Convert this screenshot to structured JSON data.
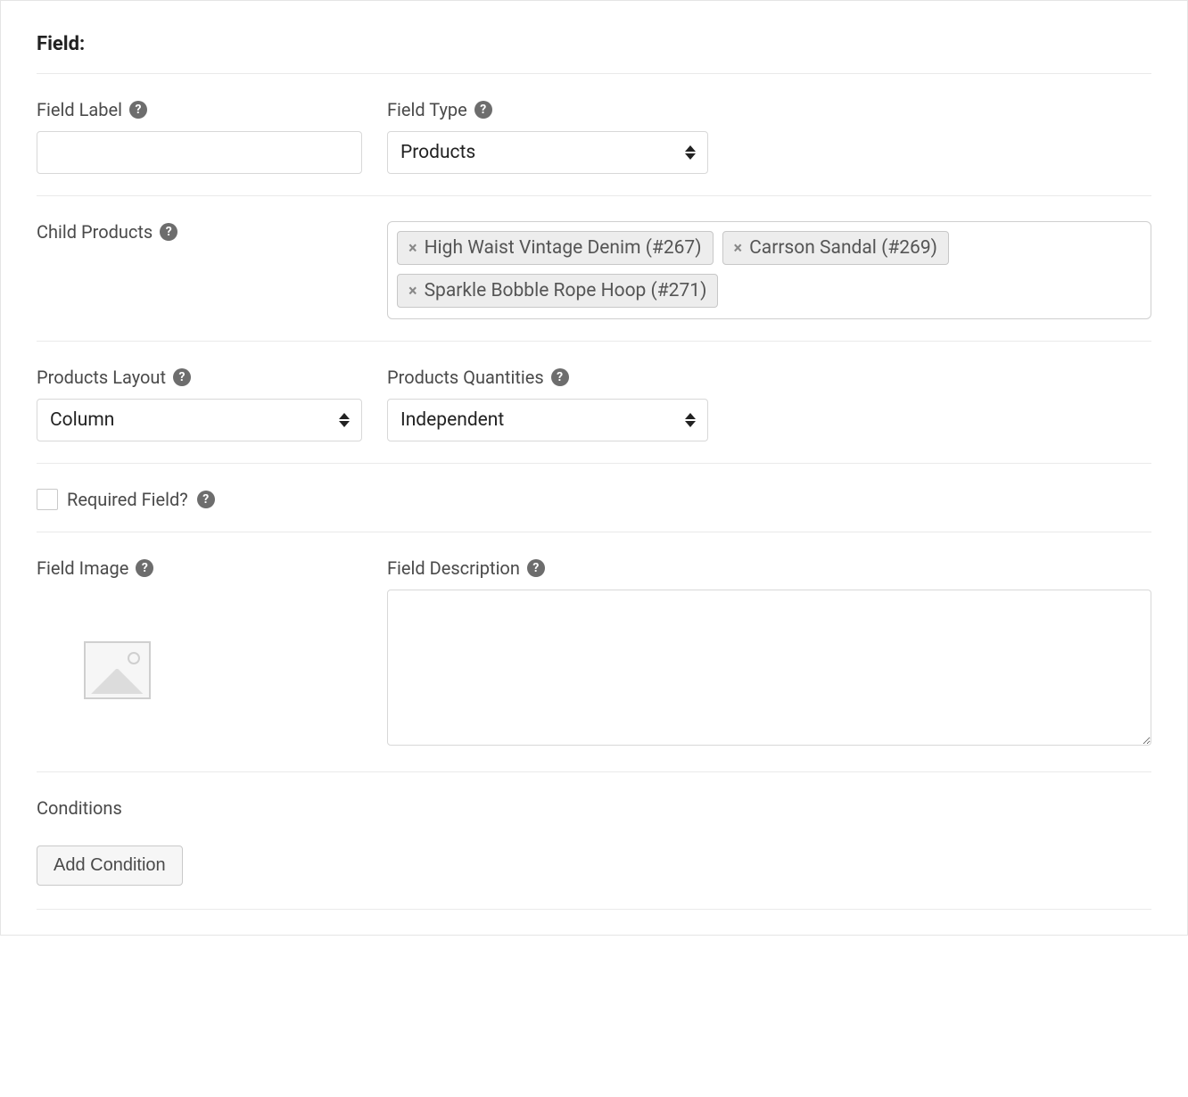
{
  "header": {
    "title": "Field:"
  },
  "fieldLabel": {
    "label": "Field Label",
    "value": ""
  },
  "fieldType": {
    "label": "Field Type",
    "selected": "Products"
  },
  "childProducts": {
    "label": "Child Products",
    "tags": [
      "High Waist Vintage Denim (#267)",
      "Carrson Sandal (#269)",
      "Sparkle Bobble Rope Hoop (#271)"
    ]
  },
  "productsLayout": {
    "label": "Products Layout",
    "selected": "Column"
  },
  "productsQuantities": {
    "label": "Products Quantities",
    "selected": "Independent"
  },
  "required": {
    "label": "Required Field?",
    "checked": false
  },
  "fieldImage": {
    "label": "Field Image"
  },
  "fieldDescription": {
    "label": "Field Description",
    "value": ""
  },
  "conditions": {
    "label": "Conditions",
    "addButton": "Add Condition"
  },
  "helpGlyph": "?"
}
